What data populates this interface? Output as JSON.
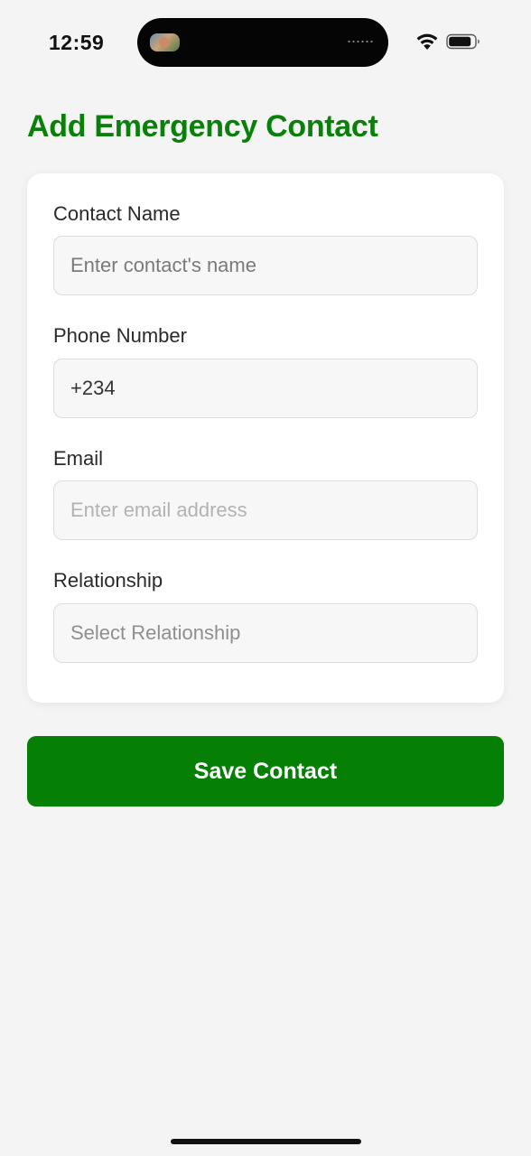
{
  "status_bar": {
    "time": "12:59"
  },
  "header": {
    "title": "Add Emergency Contact"
  },
  "form": {
    "contact_name": {
      "label": "Contact Name",
      "placeholder": "Enter contact's name",
      "value": ""
    },
    "phone_number": {
      "label": "Phone Number",
      "value": "+234"
    },
    "email": {
      "label": "Email",
      "placeholder": "Enter email address",
      "value": ""
    },
    "relationship": {
      "label": "Relationship",
      "placeholder": "Select Relationship",
      "value": ""
    }
  },
  "actions": {
    "save_label": "Save Contact"
  },
  "colors": {
    "accent": "#058005",
    "title": "#0a7f0a",
    "background": "#f4f4f4"
  }
}
